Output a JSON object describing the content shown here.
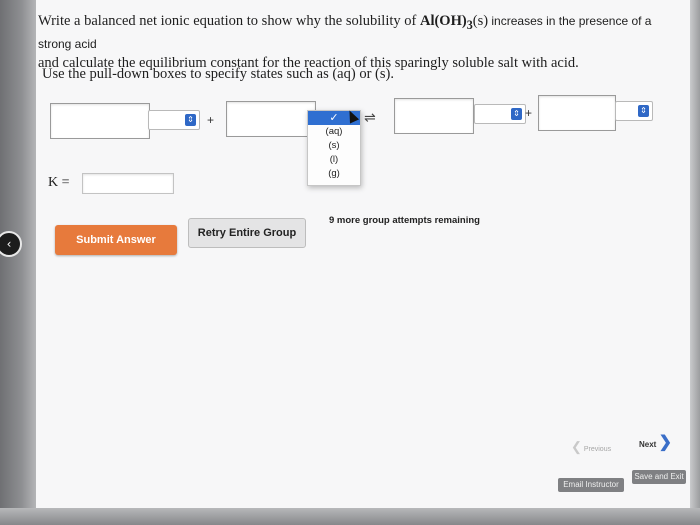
{
  "question": {
    "part1": "Write a balanced net ionic equation to show why the solubility of ",
    "formula_pre": "Al(OH)",
    "formula_sub": "3",
    "formula_state": "(s)",
    "part2": " increases in the presence of a strong acid",
    "line2": "and calculate the equilibrium constant for the reaction of this sparingly soluble salt with acid.",
    "instruction": "Use the pull-down boxes to specify states such as (aq) or (s)."
  },
  "equation": {
    "plus_left": "+",
    "plus_right": "+",
    "equilibrium_arrow": "⇌",
    "select_arrow_glyph": "⇕",
    "inputs": [
      "",
      "",
      "",
      ""
    ]
  },
  "dropdown": {
    "selected_glyph": "✓",
    "options": [
      "(aq)",
      "(s)",
      "(l)",
      "(g)"
    ]
  },
  "k": {
    "label": "K =",
    "value": ""
  },
  "buttons": {
    "submit": "Submit Answer",
    "retry": "Retry Entire Group",
    "attempts": "9 more group attempts remaining"
  },
  "navigation": {
    "back_glyph": "‹",
    "previous": "Previous",
    "next": "Next",
    "prev_chev": "❮",
    "next_chev": "❯",
    "email_instructor": "Email Instructor",
    "save_exit": "Save and Exit"
  },
  "colors": {
    "submit_bg": "#e77a3c",
    "select_arrow": "#2f68c6",
    "dropdown_selected": "#2f6fd1"
  }
}
